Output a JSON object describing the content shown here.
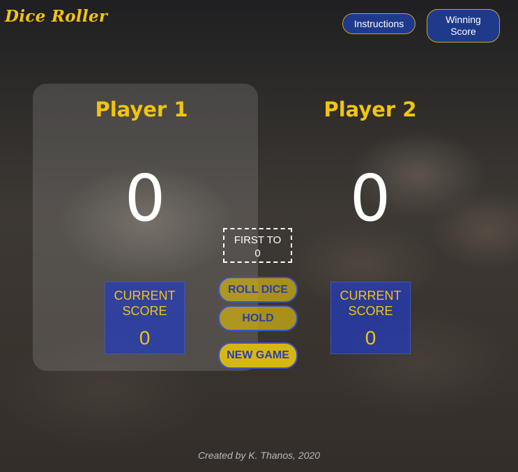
{
  "app": {
    "logo": "Dice Roller"
  },
  "header": {
    "instructions_label": "Instructions",
    "winning_score_line1": "Winning",
    "winning_score_line2": "Score"
  },
  "players": [
    {
      "name": "Player 1",
      "score": "0",
      "current_label_line1": "CURRENT",
      "current_label_line2": "SCORE",
      "current_value": "0",
      "active": true
    },
    {
      "name": "Player 2",
      "score": "0",
      "current_label_line1": "CURRENT",
      "current_label_line2": "SCORE",
      "current_value": "0",
      "active": false
    }
  ],
  "controls": {
    "first_to_label": "FIRST TO",
    "first_to_value": "0",
    "roll_dice_label": "ROLL DICE",
    "hold_label": "HOLD",
    "new_game_label": "NEW GAME"
  },
  "footer": {
    "credit": "Created by K. Thanos, 2020"
  },
  "colors": {
    "accent_yellow": "#f2c40f",
    "button_blue": "#1f3a8a",
    "current_box_blue": "#233cbe"
  }
}
